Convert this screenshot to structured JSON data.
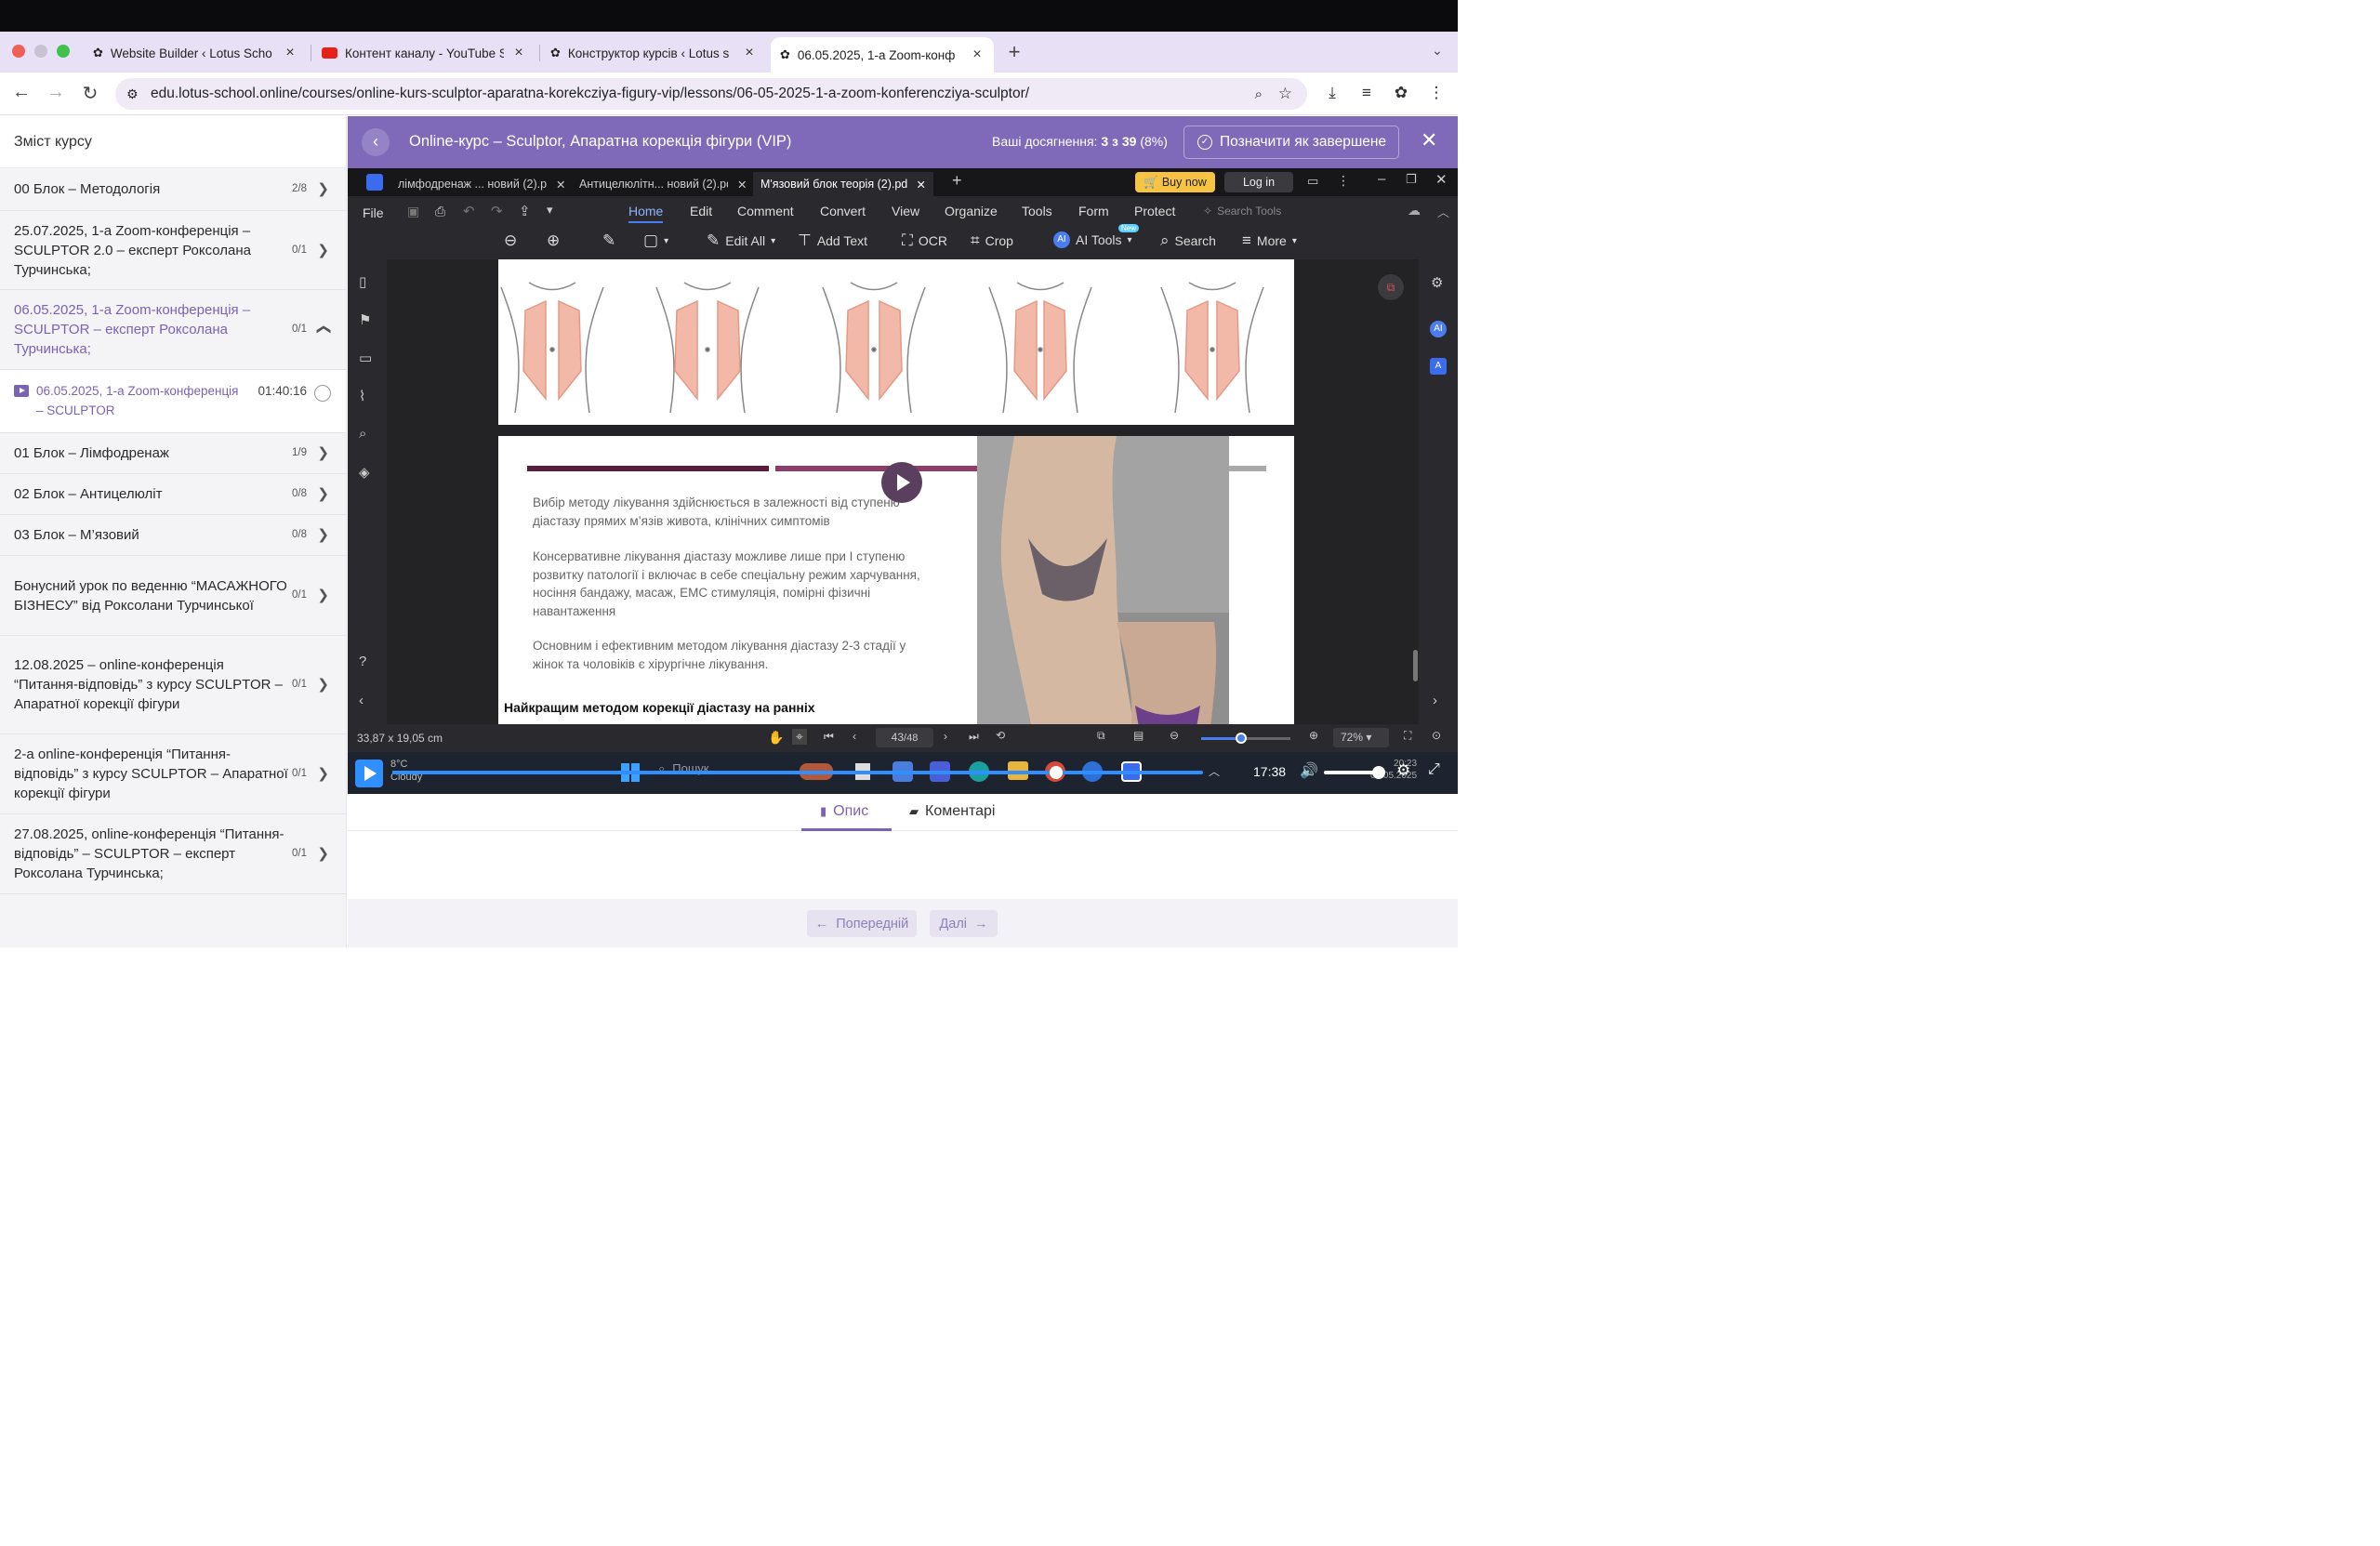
{
  "browser": {
    "tabs": [
      {
        "title": "Website Builder ‹ Lotus Scho",
        "icon": "lotus-icon"
      },
      {
        "title": "Контент каналу - YouTube St",
        "icon": "youtube-icon"
      },
      {
        "title": "Конструктор курсів ‹ Lotus s",
        "icon": "lotus-icon"
      },
      {
        "title": "06.05.2025, 1-а Zoom-конф",
        "icon": "lotus-icon"
      }
    ],
    "url": "edu.lotus-school.online/courses/online-kurs-sculptor-aparatna-korekcziya-figury-vip/lessons/06-05-2025-1-a-zoom-konferencziya-sculptor/"
  },
  "sidebar": {
    "title": "Зміст курсу",
    "modules": [
      {
        "label": "00 Блок – Методологія",
        "count": "2/8"
      },
      {
        "label": "25.07.2025, 1-а Zoom-конференція – SCULPTOR 2.0 – експерт Роксолана Турчинська;",
        "count": "0/1"
      },
      {
        "label": "06.05.2025, 1-а Zoom-конференція – SCULPTOR – експерт Роксолана Турчинська;",
        "count": "0/1"
      },
      {
        "label": "01 Блок – Лімфодренаж",
        "count": "1/9"
      },
      {
        "label": "02 Блок – Антицелюліт",
        "count": "0/8"
      },
      {
        "label": "03 Блок – М’язовий",
        "count": "0/8"
      },
      {
        "label": "Бонусний урок по веденню “МАСАЖНОГО БІЗНЕСУ” від Роксолани Турчинської",
        "count": "0/1"
      },
      {
        "label": "12.08.2025 – online-конференція “Питання-відповідь” з курсу SCULPTOR – Апаратної корекції фігури",
        "count": "0/1"
      },
      {
        "label": "2-а online-конференція “Питання-відповідь” з курсу SCULPTOR – Апаратної корекції фігури",
        "count": "0/1"
      },
      {
        "label": "27.08.2025, online-конференція “Питання-відповідь” – SCULPTOR – експерт Роксолана Турчинська;",
        "count": "0/1"
      }
    ],
    "lesson": {
      "title": "06.05.2025, 1-а Zoom-конференція – SCULPTOR",
      "duration": "01:40:16"
    }
  },
  "header": {
    "title": "Online-курс – Sculptor, Апаратна корекція фігури (VIP)",
    "achievements_label": "Ваші досягнення:",
    "achievements_value": "3 з 39",
    "achievements_pct": "(8%)",
    "complete_button": "Позначити як завершене"
  },
  "pdf": {
    "tabs": [
      "лімфодренаж ... новий (2).pdf",
      "Антицелюлітн... новий (2).pdf",
      "М'язовий блок теорія (2).pdf"
    ],
    "buy_now": "Buy now",
    "log_in": "Log in",
    "file": "File",
    "menu": [
      "Home",
      "Edit",
      "Comment",
      "Convert",
      "View",
      "Organize",
      "Tools",
      "Form",
      "Protect"
    ],
    "search_tools": "Search Tools",
    "tools": [
      "Edit All",
      "Add Text",
      "OCR",
      "Crop",
      "AI Tools",
      "Search",
      "More"
    ],
    "new_badge": "New",
    "paragraphs": [
      "Вибір методу лікування здійснюється в залежності від ступеню діастазу прямих м’язів живота, клінічних симптомів",
      "Консервативне лікування діастазу можливе лише при I ступеню розвитку патології і включає в себе спеціальну режим харчування, носіння бандажу, масаж, ЕМС стимуляція,  помірні фізичні навантаження",
      "Основним і ефективним методом лікування діастазу 2-3 стадії  у жінок та чоловіків є хірургічне лікування."
    ],
    "heading": "Найкращим методом корекції діастазу на ранніх",
    "dimensions": "33,87 x 19,05 cm",
    "page": "43",
    "pages": "/48",
    "zoom": "72%",
    "zoom_slider_pct": 45
  },
  "taskbar": {
    "temp": "8°C",
    "weather": "Cloudy",
    "search": "Пошук",
    "time": "17:38",
    "clock_time": "20:23",
    "clock_date": "06.05.2025",
    "progress_pct": 91
  },
  "content_tabs": {
    "description": "Опис",
    "comments": "Коментарі"
  },
  "footer": {
    "prev": "Попередній",
    "next": "Далі"
  }
}
